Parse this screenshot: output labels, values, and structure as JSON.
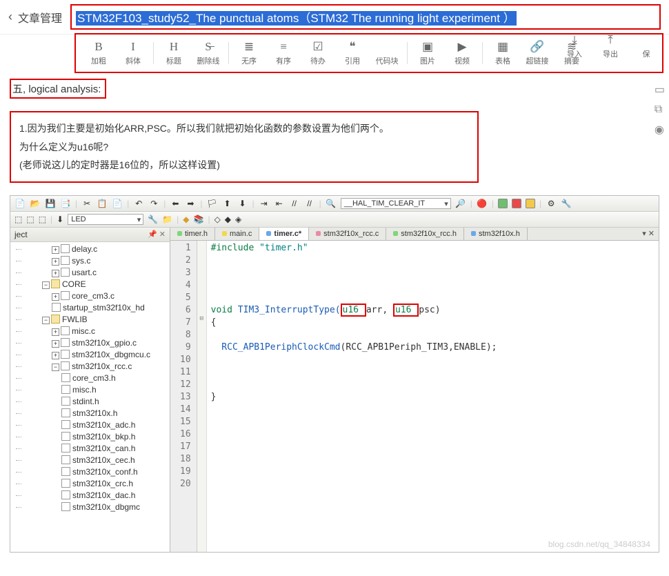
{
  "header": {
    "back_glyph": "‹",
    "crumb": "文章管理",
    "title": "STM32F103_study52_The punctual atoms（STM32 The running light experiment ）"
  },
  "toolbar": {
    "items": [
      {
        "icon": "B",
        "label": "加粗"
      },
      {
        "icon": "I",
        "label": "斜体"
      },
      {
        "sep": true
      },
      {
        "icon": "H",
        "label": "标题"
      },
      {
        "icon": "S̶",
        "label": "删除线"
      },
      {
        "sep": true
      },
      {
        "icon": "≣",
        "label": "无序"
      },
      {
        "icon": "≡",
        "label": "有序"
      },
      {
        "icon": "☑",
        "label": "待办"
      },
      {
        "icon": "❝",
        "label": "引用"
      },
      {
        "icon": "</>",
        "label": "代码块"
      },
      {
        "sep": true
      },
      {
        "icon": "▣",
        "label": "图片"
      },
      {
        "icon": "▶",
        "label": "视频"
      },
      {
        "sep": true
      },
      {
        "icon": "▦",
        "label": "表格"
      },
      {
        "icon": "🔗",
        "label": "超链接"
      },
      {
        "icon": "≋",
        "label": "摘要"
      }
    ],
    "right": [
      {
        "icon": "⤓",
        "label": "导入"
      },
      {
        "icon": "⤒",
        "label": "导出"
      },
      {
        "icon": "",
        "label": "保"
      }
    ]
  },
  "side_icons": [
    "▭",
    "⧉",
    "◉"
  ],
  "article": {
    "section_heading": "五, logical analysis:",
    "block": {
      "l1": "1.因为我们主要是初始化ARR,PSC。所以我们就把初始化函数的参数设置为他们两个。",
      "l2": "为什么定义为u16呢?",
      "l3": "(老师说这儿的定时器是16位的，所以这样设置)"
    }
  },
  "ide": {
    "toolbar1": {
      "combo": "__HAL_TIM_CLEAR_IT"
    },
    "toolbar2": {
      "target": "LED"
    },
    "project_label": "ject",
    "tree": {
      "items": [
        {
          "type": "file",
          "indent": 3,
          "exp": "+",
          "name": "delay.c"
        },
        {
          "type": "file",
          "indent": 3,
          "exp": "+",
          "name": "sys.c"
        },
        {
          "type": "file",
          "indent": 3,
          "exp": "+",
          "name": "usart.c"
        },
        {
          "type": "folder",
          "indent": 2,
          "exp": "−",
          "name": "CORE"
        },
        {
          "type": "file",
          "indent": 3,
          "exp": "+",
          "name": "core_cm3.c"
        },
        {
          "type": "file",
          "indent": 3,
          "exp": "",
          "name": "startup_stm32f10x_hd"
        },
        {
          "type": "folder",
          "indent": 2,
          "exp": "−",
          "name": "FWLIB"
        },
        {
          "type": "file",
          "indent": 3,
          "exp": "+",
          "name": "misc.c"
        },
        {
          "type": "file",
          "indent": 3,
          "exp": "+",
          "name": "stm32f10x_gpio.c"
        },
        {
          "type": "file",
          "indent": 3,
          "exp": "+",
          "name": "stm32f10x_dbgmcu.c"
        },
        {
          "type": "file",
          "indent": 3,
          "exp": "−",
          "name": "stm32f10x_rcc.c"
        },
        {
          "type": "file",
          "indent": 4,
          "exp": "",
          "name": "core_cm3.h"
        },
        {
          "type": "file",
          "indent": 4,
          "exp": "",
          "name": "misc.h"
        },
        {
          "type": "file",
          "indent": 4,
          "exp": "",
          "name": "stdint.h"
        },
        {
          "type": "file",
          "indent": 4,
          "exp": "",
          "name": "stm32f10x.h"
        },
        {
          "type": "file",
          "indent": 4,
          "exp": "",
          "name": "stm32f10x_adc.h"
        },
        {
          "type": "file",
          "indent": 4,
          "exp": "",
          "name": "stm32f10x_bkp.h"
        },
        {
          "type": "file",
          "indent": 4,
          "exp": "",
          "name": "stm32f10x_can.h"
        },
        {
          "type": "file",
          "indent": 4,
          "exp": "",
          "name": "stm32f10x_cec.h"
        },
        {
          "type": "file",
          "indent": 4,
          "exp": "",
          "name": "stm32f10x_conf.h"
        },
        {
          "type": "file",
          "indent": 4,
          "exp": "",
          "name": "stm32f10x_crc.h"
        },
        {
          "type": "file",
          "indent": 4,
          "exp": "",
          "name": "stm32f10x_dac.h"
        },
        {
          "type": "file",
          "indent": 4,
          "exp": "",
          "name": "stm32f10x_dbgmc"
        }
      ]
    },
    "tabs": [
      {
        "name": "timer.h",
        "cls": "green"
      },
      {
        "name": "main.c",
        "cls": "yellow"
      },
      {
        "name": "timer.c*",
        "cls": "blue",
        "active": true
      },
      {
        "name": "stm32f10x_rcc.c",
        "cls": "pink"
      },
      {
        "name": "stm32f10x_rcc.h",
        "cls": "green"
      },
      {
        "name": "stm32f10x.h",
        "cls": "blue"
      }
    ],
    "code": {
      "l1_a": "#include ",
      "l1_b": "\"timer.h\"",
      "l6_a": "void ",
      "l6_b": "TIM3_InterruptType",
      "l6_c": "(",
      "l6_d": "u16 ",
      "l6_e": "arr",
      "l6_f": ", ",
      "l6_g": "u16 ",
      "l6_h": "psc)",
      "l7": "{",
      "l9_a": "  RCC_APB1PeriphClockCmd",
      "l9_b": "(RCC_APB1Periph_TIM3,ENABLE);",
      "l13": "}"
    },
    "line_count": 20
  },
  "watermark": "blog.csdn.net/qq_34848334"
}
